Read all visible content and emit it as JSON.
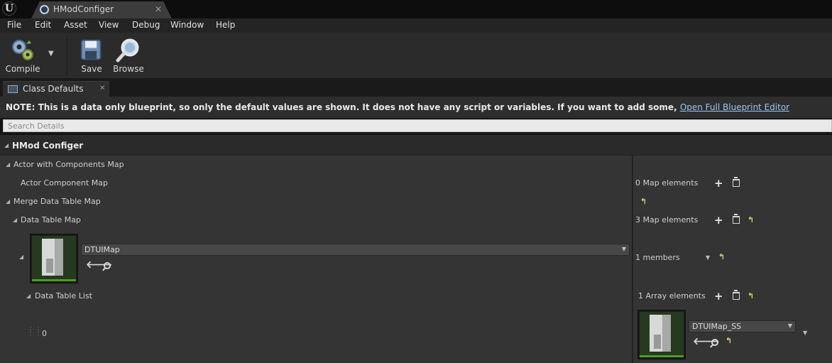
{
  "titlebar": {
    "logo": "U",
    "tab_title": "HModConfiger",
    "tab_close": "✕"
  },
  "menu": [
    "File",
    "Edit",
    "Asset",
    "View",
    "Debug",
    "Window",
    "Help"
  ],
  "toolbar": {
    "compile_label": "Compile",
    "save_label": "Save",
    "browse_label": "Browse"
  },
  "tab": {
    "label": "Class Defaults",
    "close": "✕"
  },
  "note": {
    "text": "NOTE: This is a data only blueprint, so only the default values are shown.  It does not have any script or variables.  If you want to add some, ",
    "link": "Open Full Blueprint Editor"
  },
  "search": {
    "placeholder": "Search Details"
  },
  "details": {
    "category": "HMod Configer",
    "rows": {
      "actor_with_components_map": "Actor with Components Map",
      "actor_component_map": "Actor Component Map",
      "actor_component_map_value": "0 Map elements",
      "merge_data_table_map": "Merge Data Table Map",
      "data_table_map": "Data Table Map",
      "data_table_map_value": "3 Map elements",
      "key_asset": "DTUIMap",
      "members_value": "1 members",
      "data_table_list": "Data Table List",
      "data_table_list_value": "1 Array elements",
      "index_0": "0",
      "element_asset": "DTUIMap_SS"
    }
  },
  "colors": {
    "accent_link": "#9ec6f0",
    "reset_yellow": "#d8d86a",
    "thumb_bar_green": "#4e9a27"
  }
}
